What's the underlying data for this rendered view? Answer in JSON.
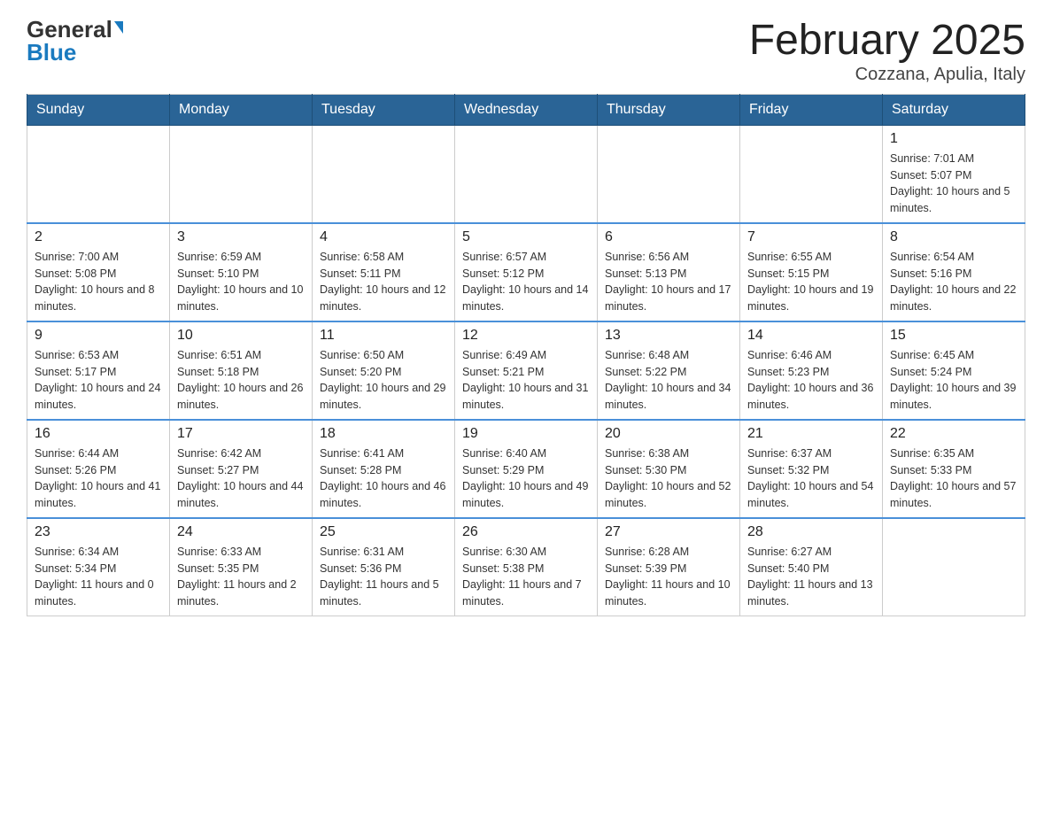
{
  "header": {
    "logo_general": "General",
    "logo_blue": "Blue",
    "title": "February 2025",
    "subtitle": "Cozzana, Apulia, Italy"
  },
  "weekdays": [
    "Sunday",
    "Monday",
    "Tuesday",
    "Wednesday",
    "Thursday",
    "Friday",
    "Saturday"
  ],
  "weeks": [
    [
      {
        "day": "",
        "info": ""
      },
      {
        "day": "",
        "info": ""
      },
      {
        "day": "",
        "info": ""
      },
      {
        "day": "",
        "info": ""
      },
      {
        "day": "",
        "info": ""
      },
      {
        "day": "",
        "info": ""
      },
      {
        "day": "1",
        "info": "Sunrise: 7:01 AM\nSunset: 5:07 PM\nDaylight: 10 hours and 5 minutes."
      }
    ],
    [
      {
        "day": "2",
        "info": "Sunrise: 7:00 AM\nSunset: 5:08 PM\nDaylight: 10 hours and 8 minutes."
      },
      {
        "day": "3",
        "info": "Sunrise: 6:59 AM\nSunset: 5:10 PM\nDaylight: 10 hours and 10 minutes."
      },
      {
        "day": "4",
        "info": "Sunrise: 6:58 AM\nSunset: 5:11 PM\nDaylight: 10 hours and 12 minutes."
      },
      {
        "day": "5",
        "info": "Sunrise: 6:57 AM\nSunset: 5:12 PM\nDaylight: 10 hours and 14 minutes."
      },
      {
        "day": "6",
        "info": "Sunrise: 6:56 AM\nSunset: 5:13 PM\nDaylight: 10 hours and 17 minutes."
      },
      {
        "day": "7",
        "info": "Sunrise: 6:55 AM\nSunset: 5:15 PM\nDaylight: 10 hours and 19 minutes."
      },
      {
        "day": "8",
        "info": "Sunrise: 6:54 AM\nSunset: 5:16 PM\nDaylight: 10 hours and 22 minutes."
      }
    ],
    [
      {
        "day": "9",
        "info": "Sunrise: 6:53 AM\nSunset: 5:17 PM\nDaylight: 10 hours and 24 minutes."
      },
      {
        "day": "10",
        "info": "Sunrise: 6:51 AM\nSunset: 5:18 PM\nDaylight: 10 hours and 26 minutes."
      },
      {
        "day": "11",
        "info": "Sunrise: 6:50 AM\nSunset: 5:20 PM\nDaylight: 10 hours and 29 minutes."
      },
      {
        "day": "12",
        "info": "Sunrise: 6:49 AM\nSunset: 5:21 PM\nDaylight: 10 hours and 31 minutes."
      },
      {
        "day": "13",
        "info": "Sunrise: 6:48 AM\nSunset: 5:22 PM\nDaylight: 10 hours and 34 minutes."
      },
      {
        "day": "14",
        "info": "Sunrise: 6:46 AM\nSunset: 5:23 PM\nDaylight: 10 hours and 36 minutes."
      },
      {
        "day": "15",
        "info": "Sunrise: 6:45 AM\nSunset: 5:24 PM\nDaylight: 10 hours and 39 minutes."
      }
    ],
    [
      {
        "day": "16",
        "info": "Sunrise: 6:44 AM\nSunset: 5:26 PM\nDaylight: 10 hours and 41 minutes."
      },
      {
        "day": "17",
        "info": "Sunrise: 6:42 AM\nSunset: 5:27 PM\nDaylight: 10 hours and 44 minutes."
      },
      {
        "day": "18",
        "info": "Sunrise: 6:41 AM\nSunset: 5:28 PM\nDaylight: 10 hours and 46 minutes."
      },
      {
        "day": "19",
        "info": "Sunrise: 6:40 AM\nSunset: 5:29 PM\nDaylight: 10 hours and 49 minutes."
      },
      {
        "day": "20",
        "info": "Sunrise: 6:38 AM\nSunset: 5:30 PM\nDaylight: 10 hours and 52 minutes."
      },
      {
        "day": "21",
        "info": "Sunrise: 6:37 AM\nSunset: 5:32 PM\nDaylight: 10 hours and 54 minutes."
      },
      {
        "day": "22",
        "info": "Sunrise: 6:35 AM\nSunset: 5:33 PM\nDaylight: 10 hours and 57 minutes."
      }
    ],
    [
      {
        "day": "23",
        "info": "Sunrise: 6:34 AM\nSunset: 5:34 PM\nDaylight: 11 hours and 0 minutes."
      },
      {
        "day": "24",
        "info": "Sunrise: 6:33 AM\nSunset: 5:35 PM\nDaylight: 11 hours and 2 minutes."
      },
      {
        "day": "25",
        "info": "Sunrise: 6:31 AM\nSunset: 5:36 PM\nDaylight: 11 hours and 5 minutes."
      },
      {
        "day": "26",
        "info": "Sunrise: 6:30 AM\nSunset: 5:38 PM\nDaylight: 11 hours and 7 minutes."
      },
      {
        "day": "27",
        "info": "Sunrise: 6:28 AM\nSunset: 5:39 PM\nDaylight: 11 hours and 10 minutes."
      },
      {
        "day": "28",
        "info": "Sunrise: 6:27 AM\nSunset: 5:40 PM\nDaylight: 11 hours and 13 minutes."
      },
      {
        "day": "",
        "info": ""
      }
    ]
  ]
}
